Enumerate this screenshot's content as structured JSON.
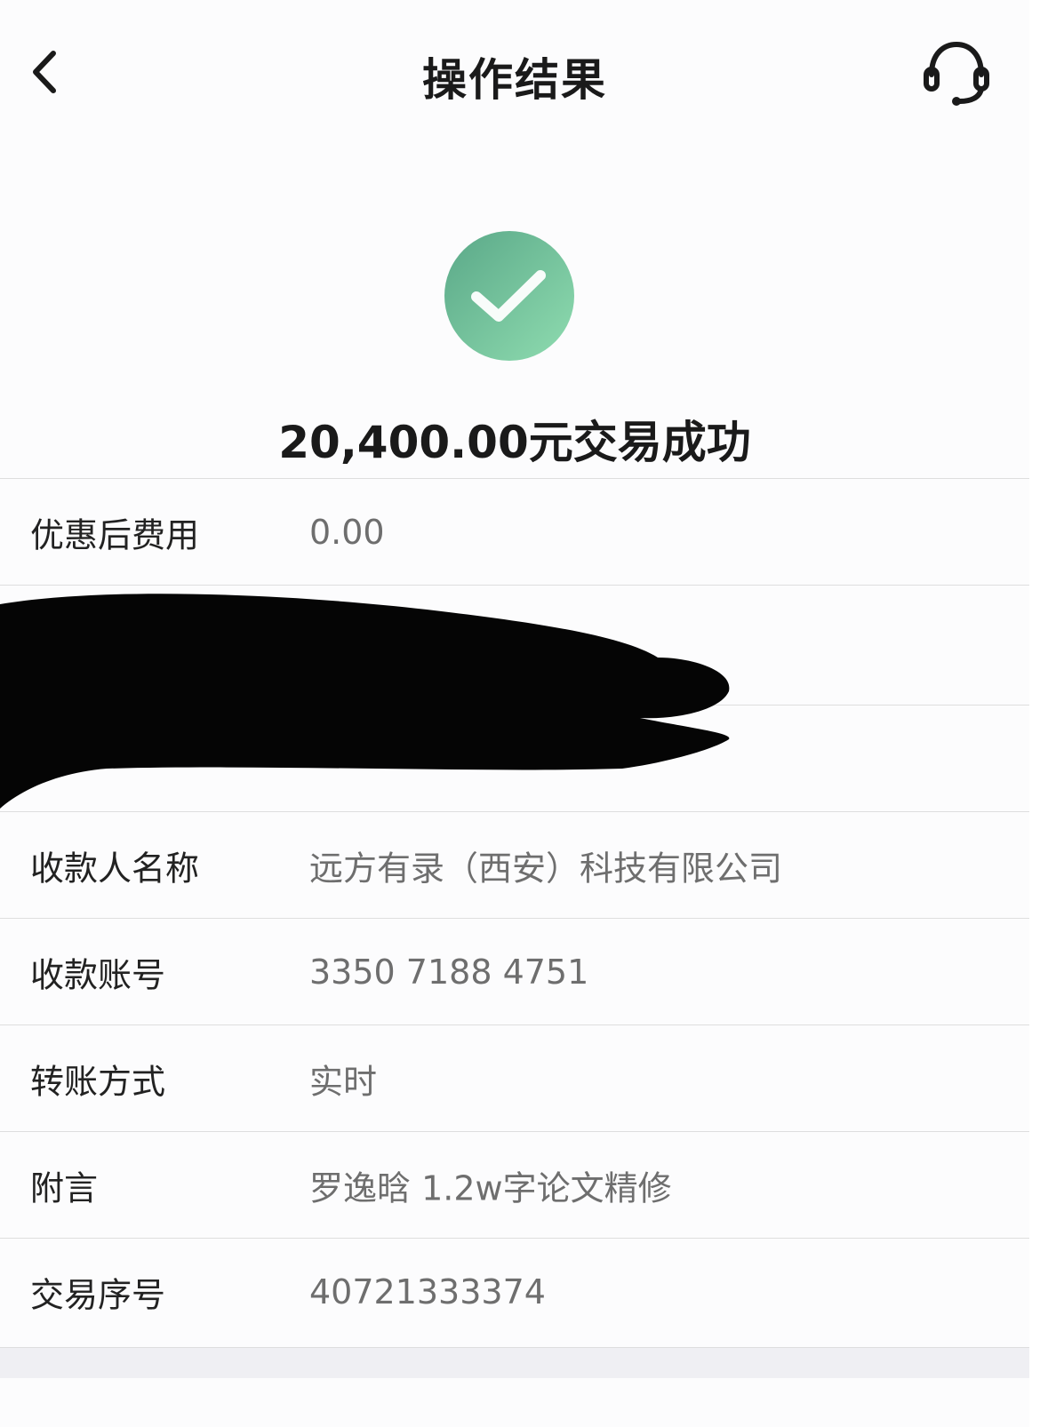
{
  "nav": {
    "title": "操作结果"
  },
  "result": {
    "headline": "20,400.00元交易成功"
  },
  "details": {
    "fee": {
      "label": "优惠后费用",
      "value": "0.00"
    },
    "payee_name": {
      "label": "收款人名称",
      "value": "远方有录（西安）科技有限公司"
    },
    "payee_account": {
      "label": "收款账号",
      "value": "3350 7188 4751"
    },
    "transfer_mode": {
      "label": "转账方式",
      "value": "实时"
    },
    "remark": {
      "label": "附言",
      "value": "罗逸晗 1.2w字论文精修"
    },
    "serial": {
      "label": "交易序号",
      "value": "40721333374"
    }
  },
  "colors": {
    "success_green": "#6cc79a",
    "text_primary": "#1a1a1a",
    "text_secondary": "#6e6e6e",
    "divider": "#dedede"
  },
  "icons": {
    "back": "chevron-left-icon",
    "service": "headset-icon",
    "success": "check-circle-icon"
  }
}
